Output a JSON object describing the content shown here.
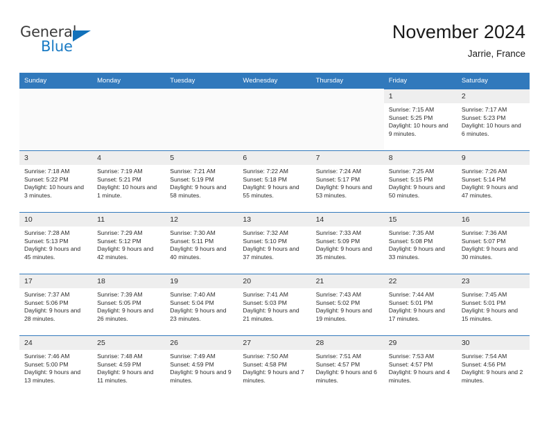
{
  "brand": {
    "name_part1": "General",
    "name_part2": "Blue",
    "accent_color": "#1271ba",
    "text_color": "#3b3b3b"
  },
  "header": {
    "title": "November 2024",
    "subtitle": "Jarrie, France"
  },
  "calendar": {
    "header_bg": "#3179bc",
    "header_text_color": "#ffffff",
    "daynum_bg": "#eeeeee",
    "weekday_labels": [
      "Sunday",
      "Monday",
      "Tuesday",
      "Wednesday",
      "Thursday",
      "Friday",
      "Saturday"
    ],
    "weeks": [
      [
        {
          "empty": true
        },
        {
          "empty": true
        },
        {
          "empty": true
        },
        {
          "empty": true
        },
        {
          "empty": true
        },
        {
          "day": "1",
          "sunrise": "Sunrise: 7:15 AM",
          "sunset": "Sunset: 5:25 PM",
          "daylight": "Daylight: 10 hours and 9 minutes."
        },
        {
          "day": "2",
          "sunrise": "Sunrise: 7:17 AM",
          "sunset": "Sunset: 5:23 PM",
          "daylight": "Daylight: 10 hours and 6 minutes."
        }
      ],
      [
        {
          "day": "3",
          "sunrise": "Sunrise: 7:18 AM",
          "sunset": "Sunset: 5:22 PM",
          "daylight": "Daylight: 10 hours and 3 minutes."
        },
        {
          "day": "4",
          "sunrise": "Sunrise: 7:19 AM",
          "sunset": "Sunset: 5:21 PM",
          "daylight": "Daylight: 10 hours and 1 minute."
        },
        {
          "day": "5",
          "sunrise": "Sunrise: 7:21 AM",
          "sunset": "Sunset: 5:19 PM",
          "daylight": "Daylight: 9 hours and 58 minutes."
        },
        {
          "day": "6",
          "sunrise": "Sunrise: 7:22 AM",
          "sunset": "Sunset: 5:18 PM",
          "daylight": "Daylight: 9 hours and 55 minutes."
        },
        {
          "day": "7",
          "sunrise": "Sunrise: 7:24 AM",
          "sunset": "Sunset: 5:17 PM",
          "daylight": "Daylight: 9 hours and 53 minutes."
        },
        {
          "day": "8",
          "sunrise": "Sunrise: 7:25 AM",
          "sunset": "Sunset: 5:15 PM",
          "daylight": "Daylight: 9 hours and 50 minutes."
        },
        {
          "day": "9",
          "sunrise": "Sunrise: 7:26 AM",
          "sunset": "Sunset: 5:14 PM",
          "daylight": "Daylight: 9 hours and 47 minutes."
        }
      ],
      [
        {
          "day": "10",
          "sunrise": "Sunrise: 7:28 AM",
          "sunset": "Sunset: 5:13 PM",
          "daylight": "Daylight: 9 hours and 45 minutes."
        },
        {
          "day": "11",
          "sunrise": "Sunrise: 7:29 AM",
          "sunset": "Sunset: 5:12 PM",
          "daylight": "Daylight: 9 hours and 42 minutes."
        },
        {
          "day": "12",
          "sunrise": "Sunrise: 7:30 AM",
          "sunset": "Sunset: 5:11 PM",
          "daylight": "Daylight: 9 hours and 40 minutes."
        },
        {
          "day": "13",
          "sunrise": "Sunrise: 7:32 AM",
          "sunset": "Sunset: 5:10 PM",
          "daylight": "Daylight: 9 hours and 37 minutes."
        },
        {
          "day": "14",
          "sunrise": "Sunrise: 7:33 AM",
          "sunset": "Sunset: 5:09 PM",
          "daylight": "Daylight: 9 hours and 35 minutes."
        },
        {
          "day": "15",
          "sunrise": "Sunrise: 7:35 AM",
          "sunset": "Sunset: 5:08 PM",
          "daylight": "Daylight: 9 hours and 33 minutes."
        },
        {
          "day": "16",
          "sunrise": "Sunrise: 7:36 AM",
          "sunset": "Sunset: 5:07 PM",
          "daylight": "Daylight: 9 hours and 30 minutes."
        }
      ],
      [
        {
          "day": "17",
          "sunrise": "Sunrise: 7:37 AM",
          "sunset": "Sunset: 5:06 PM",
          "daylight": "Daylight: 9 hours and 28 minutes."
        },
        {
          "day": "18",
          "sunrise": "Sunrise: 7:39 AM",
          "sunset": "Sunset: 5:05 PM",
          "daylight": "Daylight: 9 hours and 26 minutes."
        },
        {
          "day": "19",
          "sunrise": "Sunrise: 7:40 AM",
          "sunset": "Sunset: 5:04 PM",
          "daylight": "Daylight: 9 hours and 23 minutes."
        },
        {
          "day": "20",
          "sunrise": "Sunrise: 7:41 AM",
          "sunset": "Sunset: 5:03 PM",
          "daylight": "Daylight: 9 hours and 21 minutes."
        },
        {
          "day": "21",
          "sunrise": "Sunrise: 7:43 AM",
          "sunset": "Sunset: 5:02 PM",
          "daylight": "Daylight: 9 hours and 19 minutes."
        },
        {
          "day": "22",
          "sunrise": "Sunrise: 7:44 AM",
          "sunset": "Sunset: 5:01 PM",
          "daylight": "Daylight: 9 hours and 17 minutes."
        },
        {
          "day": "23",
          "sunrise": "Sunrise: 7:45 AM",
          "sunset": "Sunset: 5:01 PM",
          "daylight": "Daylight: 9 hours and 15 minutes."
        }
      ],
      [
        {
          "day": "24",
          "sunrise": "Sunrise: 7:46 AM",
          "sunset": "Sunset: 5:00 PM",
          "daylight": "Daylight: 9 hours and 13 minutes."
        },
        {
          "day": "25",
          "sunrise": "Sunrise: 7:48 AM",
          "sunset": "Sunset: 4:59 PM",
          "daylight": "Daylight: 9 hours and 11 minutes."
        },
        {
          "day": "26",
          "sunrise": "Sunrise: 7:49 AM",
          "sunset": "Sunset: 4:59 PM",
          "daylight": "Daylight: 9 hours and 9 minutes."
        },
        {
          "day": "27",
          "sunrise": "Sunrise: 7:50 AM",
          "sunset": "Sunset: 4:58 PM",
          "daylight": "Daylight: 9 hours and 7 minutes."
        },
        {
          "day": "28",
          "sunrise": "Sunrise: 7:51 AM",
          "sunset": "Sunset: 4:57 PM",
          "daylight": "Daylight: 9 hours and 6 minutes."
        },
        {
          "day": "29",
          "sunrise": "Sunrise: 7:53 AM",
          "sunset": "Sunset: 4:57 PM",
          "daylight": "Daylight: 9 hours and 4 minutes."
        },
        {
          "day": "30",
          "sunrise": "Sunrise: 7:54 AM",
          "sunset": "Sunset: 4:56 PM",
          "daylight": "Daylight: 9 hours and 2 minutes."
        }
      ]
    ]
  }
}
